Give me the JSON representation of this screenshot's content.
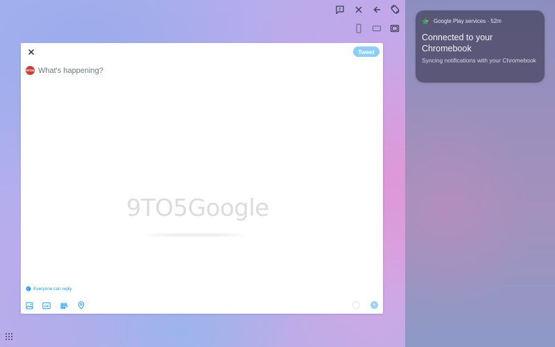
{
  "compose": {
    "tweet_button_label": "Tweet",
    "placeholder": "What's happening?",
    "avatar_text": "9TO5",
    "reply_setting_label": "Everyone can reply",
    "watermark_text": "9TO5Google"
  },
  "notification": {
    "source": "Google Play services · 52m",
    "title": "Connected to your Chromebook",
    "body": "Syncing notifications with your Chromebook"
  },
  "icons": {
    "window_controls": [
      "feedback-icon",
      "close-icon",
      "back-icon",
      "rotate-icon"
    ],
    "resize_controls": [
      "phone-size-icon",
      "tablet-size-icon",
      "resizable-icon"
    ],
    "compose_tools": [
      "image-icon",
      "gif-icon",
      "poll-icon",
      "location-icon"
    ]
  },
  "colors": {
    "accent": "#1d9bf0",
    "tweet_button": "#8ecdf7",
    "notification_bg": "#52506e"
  }
}
